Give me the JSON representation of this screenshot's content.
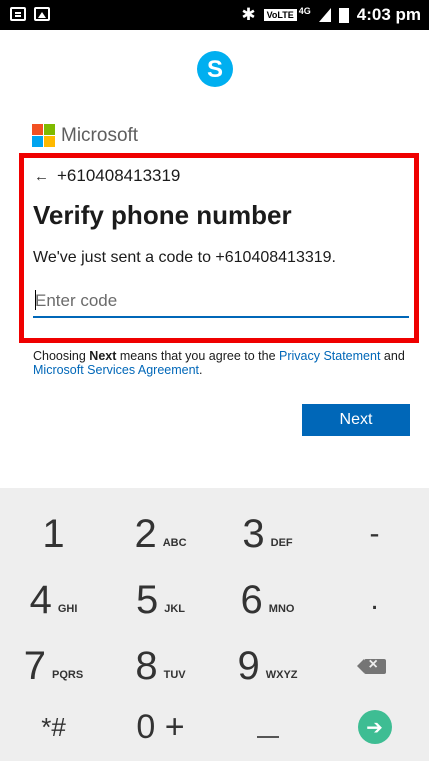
{
  "status_bar": {
    "volte": "VoLTE",
    "network": "4G",
    "time": "4:03 pm"
  },
  "brand": {
    "name": "Microsoft"
  },
  "colors": {
    "accent": "#0067b8",
    "highlight": "#ef0000",
    "skype": "#00aff0",
    "go": "#3ebd93"
  },
  "verify": {
    "back_arrow": "←",
    "phone": "+610408413319",
    "title": "Verify phone number",
    "description": "We've just sent a code to +610408413319.",
    "code_placeholder": "Enter code",
    "code_value": ""
  },
  "legal": {
    "prefix": "Choosing ",
    "next_word": "Next",
    "middle": " means that you agree to the ",
    "privacy_link": "Privacy Statement",
    "and": " and ",
    "services_link": "Microsoft Services Agreement",
    "suffix": "."
  },
  "actions": {
    "next_label": "Next"
  },
  "keypad": {
    "keys": [
      {
        "digit": "1",
        "letters": ""
      },
      {
        "digit": "2",
        "letters": "ABC"
      },
      {
        "digit": "3",
        "letters": "DEF"
      },
      {
        "digit": "-",
        "letters": ""
      },
      {
        "digit": "4",
        "letters": "GHI"
      },
      {
        "digit": "5",
        "letters": "JKL"
      },
      {
        "digit": "6",
        "letters": "MNO"
      },
      {
        "digit": ".",
        "letters": ""
      },
      {
        "digit": "7",
        "letters": "PQRS"
      },
      {
        "digit": "8",
        "letters": "TUV"
      },
      {
        "digit": "9",
        "letters": "WXYZ"
      },
      {
        "digit": "*#",
        "letters": ""
      },
      {
        "digit": "0 +",
        "letters": ""
      }
    ],
    "icons": {
      "delete": "backspace-icon",
      "go": "arrow-right-icon",
      "space": "space-key"
    }
  }
}
